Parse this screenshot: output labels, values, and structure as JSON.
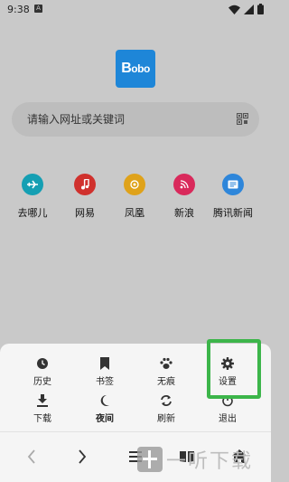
{
  "status_bar": {
    "time": "9:38",
    "notification_icon": "A",
    "icons": [
      "wifi-icon",
      "signal-icon",
      "battery-icon"
    ]
  },
  "logo": {
    "text_big": "B",
    "text_small": "obo"
  },
  "search": {
    "placeholder": "请输入网址或关键词",
    "scan_icon": "scan-icon"
  },
  "quick_links": [
    {
      "label": "去哪儿",
      "icon": "airplane-icon",
      "color": "#159fb3"
    },
    {
      "label": "网易",
      "icon": "music-icon",
      "color": "#d0312d"
    },
    {
      "label": "凤凰",
      "icon": "phoenix-icon",
      "color": "#dfa21a"
    },
    {
      "label": "新浪",
      "icon": "rss-icon",
      "color": "#d9295b"
    },
    {
      "label": "腾讯新闻",
      "icon": "news-icon",
      "color": "#2e86da"
    }
  ],
  "menu": {
    "row1": [
      {
        "label": "历史",
        "icon": "clock-icon"
      },
      {
        "label": "书签",
        "icon": "bookmark-icon"
      },
      {
        "label": "无痕",
        "icon": "paw-icon"
      },
      {
        "label": "设置",
        "icon": "gear-icon"
      }
    ],
    "row2": [
      {
        "label": "下载",
        "icon": "download-icon"
      },
      {
        "label": "夜间",
        "icon": "moon-icon"
      },
      {
        "label": "刷新",
        "icon": "refresh-icon"
      },
      {
        "label": "退出",
        "icon": "power-icon"
      }
    ],
    "highlight_color": "#3cb54a"
  },
  "bottom_nav": {
    "icons": [
      "back-icon",
      "forward-icon",
      "menu-icon",
      "book-icon",
      "home-icon"
    ]
  },
  "watermark": {
    "text": "一听下载"
  }
}
